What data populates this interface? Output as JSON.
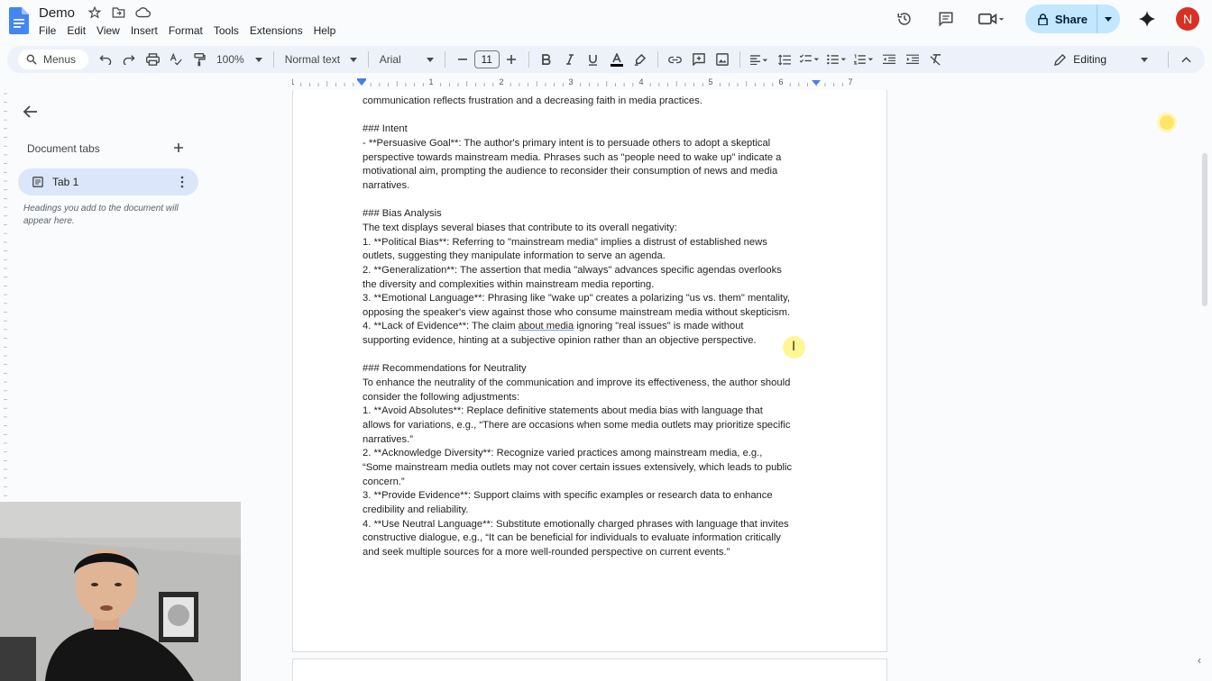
{
  "window": {
    "doc_title": "Demo",
    "menu": [
      "File",
      "Edit",
      "View",
      "Insert",
      "Format",
      "Tools",
      "Extensions",
      "Help"
    ],
    "share_label": "Share",
    "avatar_letter": "N"
  },
  "toolbar": {
    "search_label": "Menus",
    "zoom": "100%",
    "style": "Normal text",
    "font": "Arial",
    "font_size": "11",
    "mode": "Editing"
  },
  "ruler": {
    "numbers": [
      "1",
      "1",
      "2",
      "3",
      "4",
      "5",
      "6",
      "7"
    ]
  },
  "sidebar": {
    "title": "Document tabs",
    "tab_label": "Tab 1",
    "hint": "Headings you add to the document will appear here."
  },
  "document": {
    "lines": [
      "communication reflects frustration and a decreasing faith in media practices.",
      "",
      "### Intent",
      "- **Persuasive Goal**: The author's primary intent is to persuade others to adopt a skeptical",
      "perspective towards mainstream media. Phrases such as \"people need to wake up\" indicate a",
      "motivational aim, prompting the audience to reconsider their consumption of news and media",
      "narratives.",
      "",
      "### Bias Analysis",
      "The text displays several biases that contribute to its overall negativity:",
      "1. **Political Bias**: Referring to \"mainstream media\" implies a distrust of established news",
      "outlets, suggesting they manipulate information to serve an agenda.",
      "2. **Generalization**: The assertion that media \"always\" advances specific agendas overlooks",
      "the diversity and complexities within mainstream media reporting.",
      "3. **Emotional Language**: Phrasing like \"wake up\" creates a polarizing \"us vs. them\" mentality,",
      "opposing the speaker's view against those who consume mainstream media without skepticism.",
      "4. **Lack of Evidence**: The claim about media ignoring \"real issues\" is made without",
      "supporting evidence, hinting at a subjective opinion rather than an objective perspective.",
      "",
      "### Recommendations for Neutrality",
      "To enhance the neutrality of the communication and improve its effectiveness, the author should",
      "consider the following adjustments:",
      "1. **Avoid Absolutes**: Replace definitive statements about media bias with language that",
      "allows for variations, e.g., “There are occasions when some media outlets may prioritize specific",
      "narratives.”",
      "2. **Acknowledge Diversity**: Recognize varied practices among mainstream media, e.g.,",
      "“Some mainstream media outlets may not cover certain issues extensively, which leads to public",
      "concern.”",
      "3. **Provide Evidence**: Support claims with specific examples or research data to enhance",
      "credibility and reliability.",
      "4. **Use Neutral Language**: Substitute emotionally charged phrases with language that invites",
      "constructive dialogue, e.g., “It can be beneficial for individuals to evaluate information critically",
      "and seek multiple sources for a more well-rounded perspective on current events.”"
    ]
  },
  "colors": {
    "accent": "#0b57d0",
    "share_bg": "#c2e7ff",
    "toolbar_bg": "#edf2fa",
    "tab_selected": "#dbe6fb",
    "avatar": "#d93025"
  }
}
